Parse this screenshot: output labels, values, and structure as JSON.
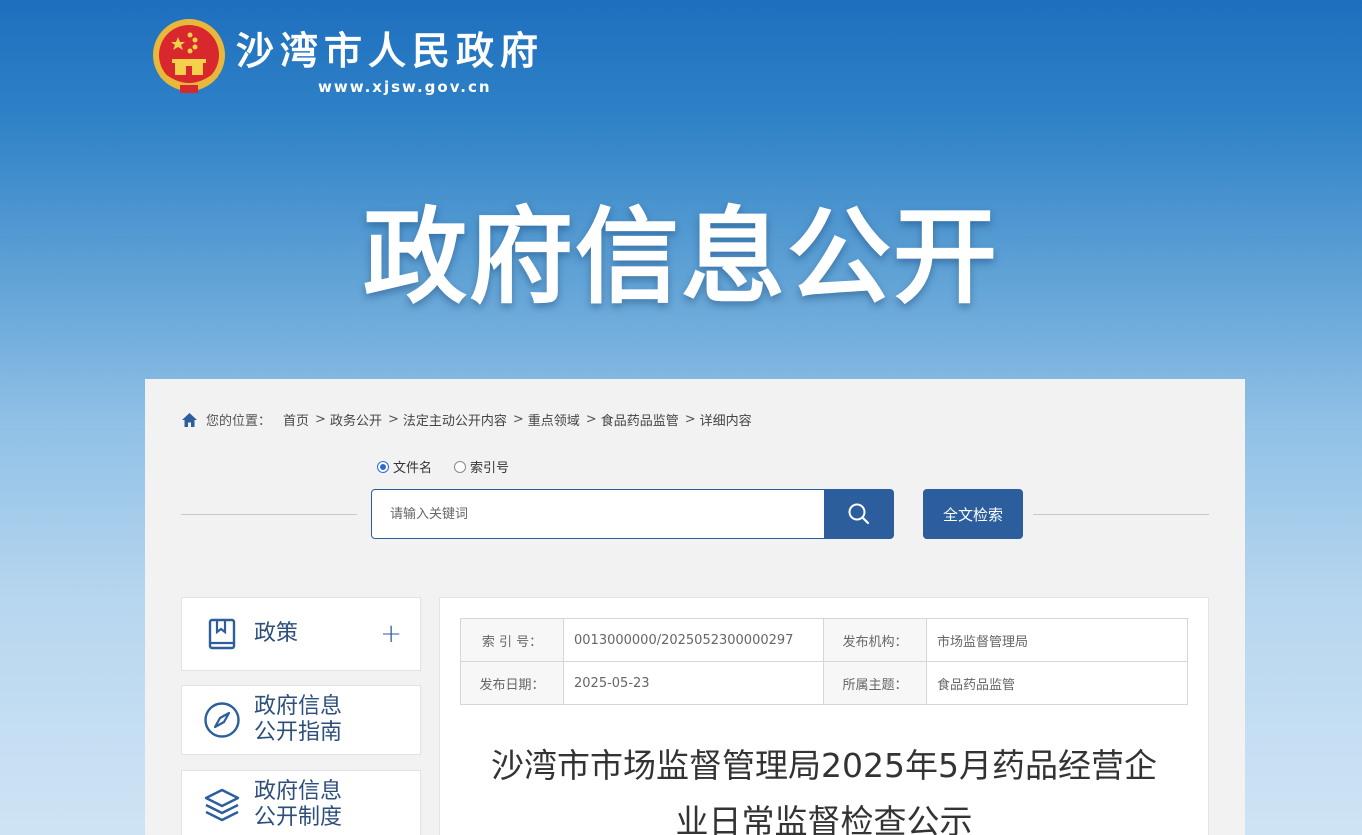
{
  "header": {
    "site_title": "沙湾市人民政府",
    "site_url": "www.xjsw.gov.cn",
    "banner_title": "政府信息公开"
  },
  "breadcrumb": {
    "location_label": "您的位置：",
    "items": [
      "首页",
      "政务公开",
      "法定主动公开内容",
      "重点领域",
      "食品药品监管",
      "详细内容"
    ]
  },
  "search": {
    "options": [
      {
        "label": "文件名",
        "checked": true
      },
      {
        "label": "索引号",
        "checked": false
      }
    ],
    "placeholder": "请输入关键词",
    "fulltext_label": "全文检索"
  },
  "sidebar": {
    "items": [
      {
        "line1": "政策",
        "line2": "",
        "icon": "book-icon"
      },
      {
        "line1": "政府信息",
        "line2": "公开指南",
        "icon": "compass-icon"
      },
      {
        "line1": "政府信息",
        "line2": "公开制度",
        "icon": "layers-icon"
      }
    ]
  },
  "meta": {
    "index_label": "索 引 号：",
    "index_value": "0013000000/2025052300000297",
    "publisher_label": "发布机构：",
    "publisher_value": "市场监督管理局",
    "date_label": "发布日期：",
    "date_value": "2025-05-23",
    "topic_label": "所属主题：",
    "topic_value": "食品药品监管"
  },
  "document": {
    "title_line1": "沙湾市市场监督管理局2025年5月药品经营企",
    "title_line2": "业日常监督检查公示"
  },
  "colors": {
    "primary": "#2c5e9e",
    "banner_top": "#1e6fbe",
    "banner_bottom": "#cfe4f5"
  }
}
